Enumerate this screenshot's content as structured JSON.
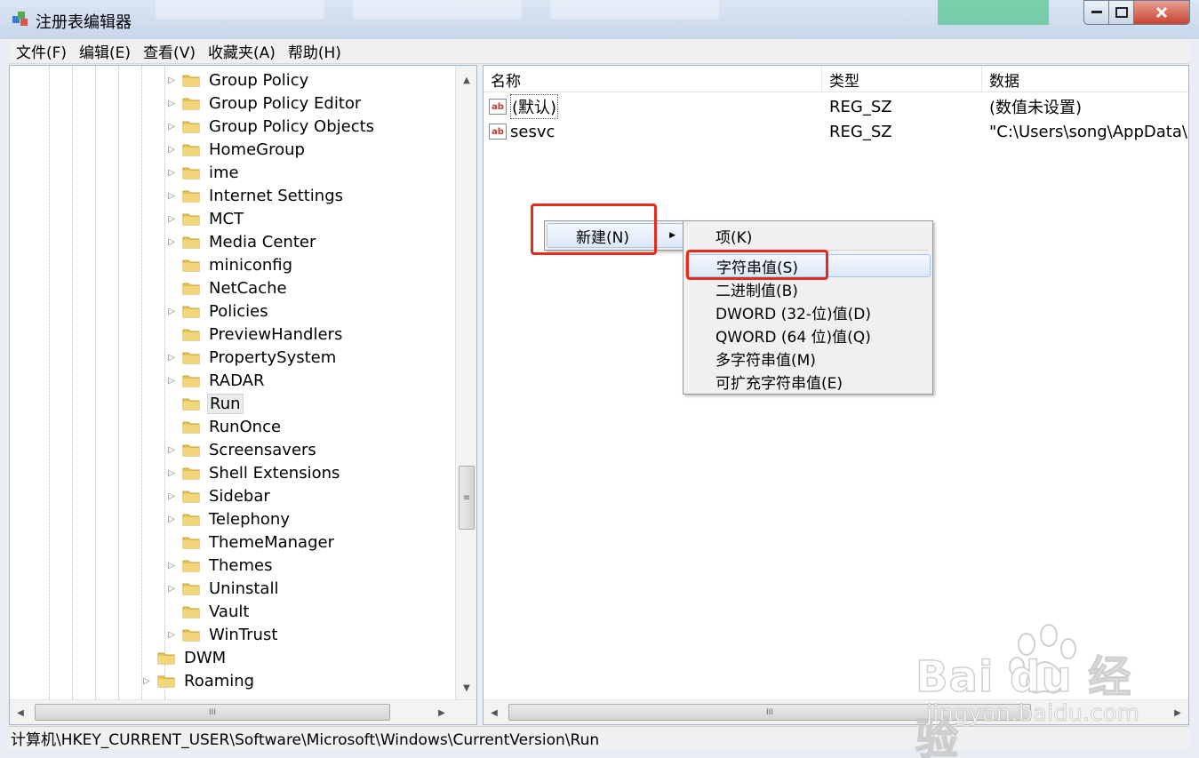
{
  "window": {
    "title": "注册表编辑器"
  },
  "menu": [
    "文件(F)",
    "编辑(E)",
    "查看(V)",
    "收藏夹(A)",
    "帮助(H)"
  ],
  "tree": {
    "items": [
      {
        "label": "Group Policy",
        "expandable": true
      },
      {
        "label": "Group Policy Editor",
        "expandable": true
      },
      {
        "label": "Group Policy Objects",
        "expandable": true
      },
      {
        "label": "HomeGroup",
        "expandable": true
      },
      {
        "label": "ime",
        "expandable": true
      },
      {
        "label": "Internet Settings",
        "expandable": true
      },
      {
        "label": "MCT",
        "expandable": true
      },
      {
        "label": "Media Center",
        "expandable": true
      },
      {
        "label": "miniconfig",
        "expandable": false
      },
      {
        "label": "NetCache",
        "expandable": false
      },
      {
        "label": "Policies",
        "expandable": true
      },
      {
        "label": "PreviewHandlers",
        "expandable": false
      },
      {
        "label": "PropertySystem",
        "expandable": true
      },
      {
        "label": "RADAR",
        "expandable": true
      },
      {
        "label": "Run",
        "expandable": false,
        "selected": true
      },
      {
        "label": "RunOnce",
        "expandable": false
      },
      {
        "label": "Screensavers",
        "expandable": true
      },
      {
        "label": "Shell Extensions",
        "expandable": true
      },
      {
        "label": "Sidebar",
        "expandable": true
      },
      {
        "label": "Telephony",
        "expandable": true
      },
      {
        "label": "ThemeManager",
        "expandable": false
      },
      {
        "label": "Themes",
        "expandable": true
      },
      {
        "label": "Uninstall",
        "expandable": true
      },
      {
        "label": "Vault",
        "expandable": false
      },
      {
        "label": "WinTrust",
        "expandable": true
      }
    ],
    "parent_items": [
      {
        "label": "DWM",
        "expandable": false
      },
      {
        "label": "Roaming",
        "expandable": true
      }
    ]
  },
  "list": {
    "columns": [
      "名称",
      "类型",
      "数据"
    ],
    "rows": [
      {
        "name": "(默认)",
        "type": "REG_SZ",
        "data": "(数值未设置)"
      },
      {
        "name": "sesvc",
        "type": "REG_SZ",
        "data": "\"C:\\Users\\song\\AppData\\R"
      }
    ]
  },
  "context_menu": {
    "new_label": "新建(N)",
    "submenu": [
      "项(K)",
      "字符串值(S)",
      "二进制值(B)",
      "DWORD (32-位)值(D)",
      "QWORD (64 位)值(Q)",
      "多字符串值(M)",
      "可扩充字符串值(E)"
    ],
    "highlighted": "字符串值(S)"
  },
  "status": {
    "path": "计算机\\HKEY_CURRENT_USER\\Software\\Microsoft\\Windows\\CurrentVersion\\Run"
  },
  "watermark": {
    "logo": "Bai du 经验",
    "url": "jingyan.baidu.com"
  },
  "colors": {
    "highlight_box": "#e52a1e",
    "menu_hover": "#dde9f8",
    "folder": "#e8c45a"
  }
}
